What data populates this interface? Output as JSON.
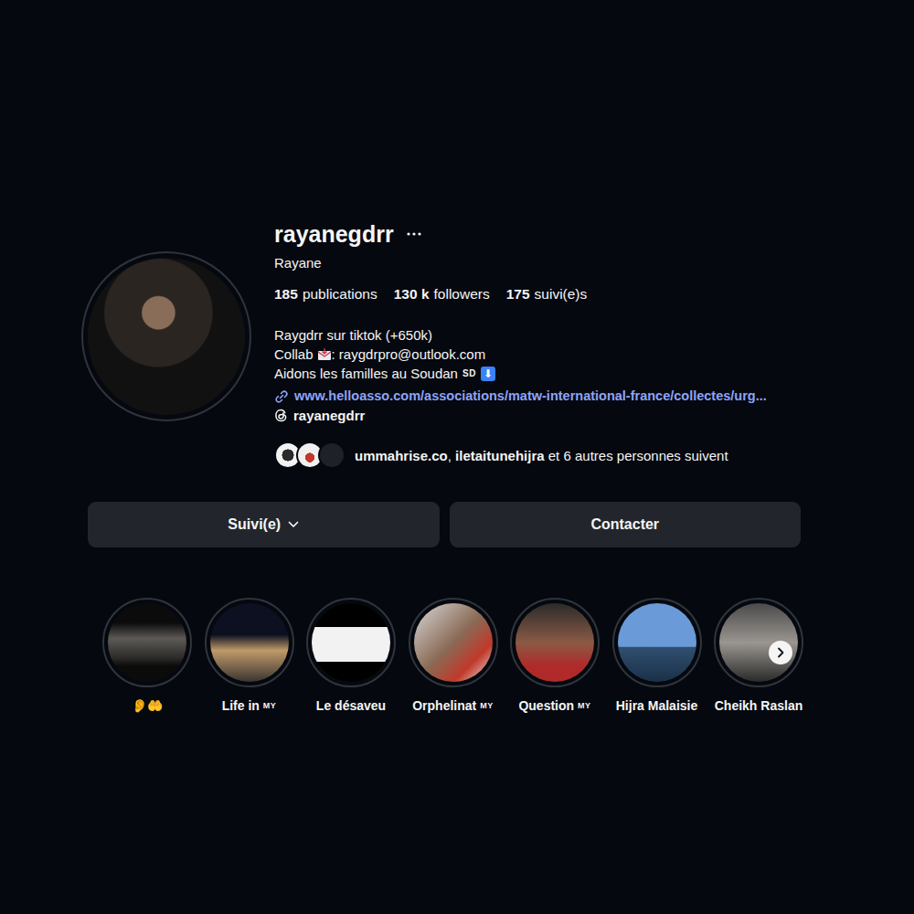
{
  "profile": {
    "username": "rayanegdrr",
    "name": "Rayane"
  },
  "stats": [
    {
      "value": "185",
      "label": "publications"
    },
    {
      "value": "130 k",
      "label": "followers"
    },
    {
      "value": "175",
      "label": "suivi(e)s"
    }
  ],
  "bio": {
    "line1": "Raygdrr sur tiktok (+650k)",
    "collab_label": "Collab",
    "collab_text": ": raygdrpro@outlook.com",
    "line3": "Aidons les familles au Soudan",
    "line3_flag": "SD",
    "line3_arrow": "⬇"
  },
  "link": "www.helloasso.com/associations/matw-international-france/collectes/urg...",
  "threads": "rayanegdrr",
  "followed_by": [
    {
      "text": "ummahrise.co",
      "bold": true
    },
    {
      "text": ", ",
      "bold": false
    },
    {
      "text": "iletaitunehijra",
      "bold": true
    },
    {
      "text": " et 6 autres personnes suivent",
      "bold": false
    }
  ],
  "buttons": [
    {
      "label": "Suivi(e)",
      "dropdown": true
    },
    {
      "label": "Contacter",
      "dropdown": false
    }
  ],
  "highlights": [
    {
      "label": "👂🤲",
      "flag": ""
    },
    {
      "label": "Life in",
      "flag": "MY"
    },
    {
      "label": "Le désaveu",
      "flag": ""
    },
    {
      "label": "Orphelinat",
      "flag": "MY"
    },
    {
      "label": "Question",
      "flag": "MY"
    },
    {
      "label": "Hijra Malaisie",
      "flag": ""
    },
    {
      "label": "Cheikh Raslan",
      "flag": ""
    }
  ]
}
